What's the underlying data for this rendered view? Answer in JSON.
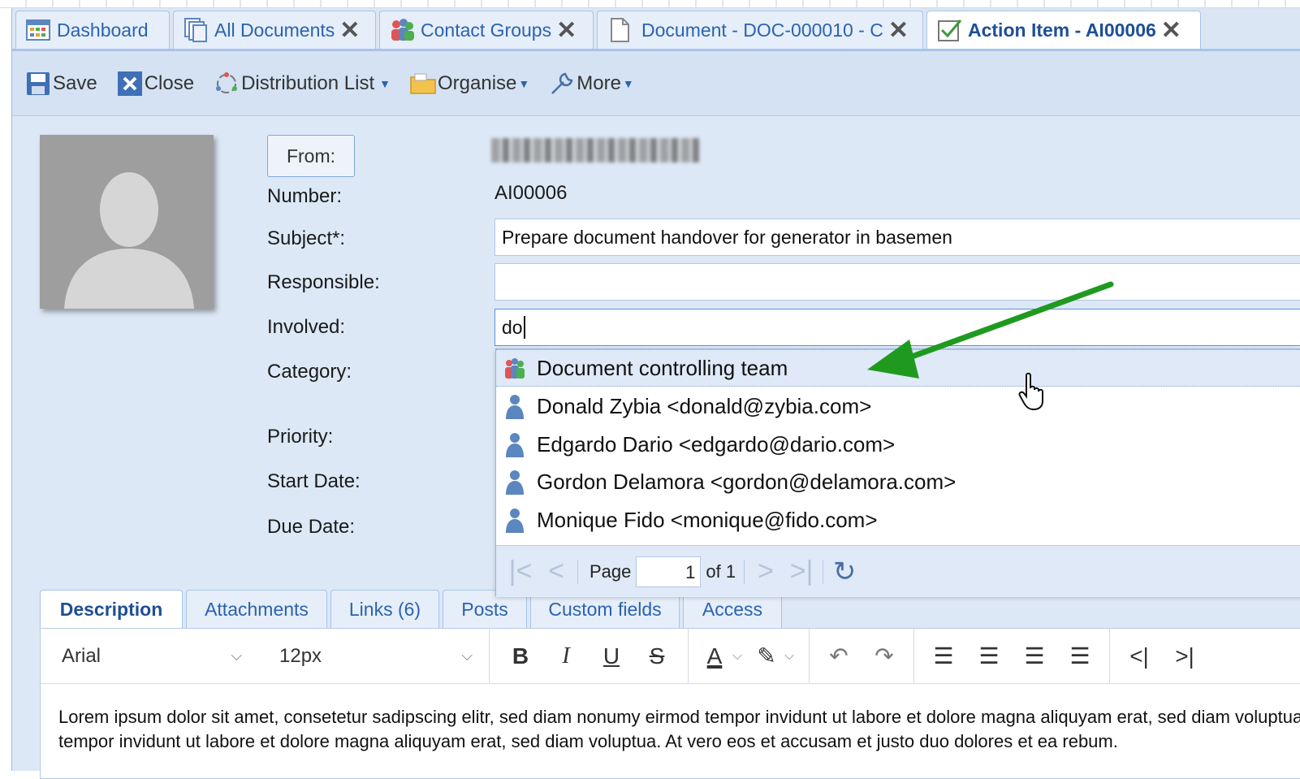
{
  "tabs": [
    {
      "label": "Dashboard",
      "icon": "dashboard-icon",
      "closable": false,
      "active": false
    },
    {
      "label": "All Documents",
      "icon": "documents-icon",
      "closable": true,
      "active": false
    },
    {
      "label": "Contact Groups",
      "icon": "contact-group-icon",
      "closable": true,
      "active": false
    },
    {
      "label": "Document - DOC-000010 - C",
      "icon": "document-icon",
      "closable": true,
      "active": false
    },
    {
      "label": "Action Item - AI00006",
      "icon": "checkbox-icon",
      "closable": true,
      "active": true
    }
  ],
  "toolbar": {
    "save": "Save",
    "close": "Close",
    "distribution_list": "Distribution List",
    "organise": "Organise",
    "more": "More"
  },
  "form": {
    "from_button": "From:",
    "number_label": "Number:",
    "number_value": "AI00006",
    "subject_label": "Subject*:",
    "subject_value": "Prepare document handover for generator in basemen",
    "responsible_label": "Responsible:",
    "responsible_value": "",
    "involved_label": "Involved:",
    "involved_value": "do",
    "category_label": "Category:",
    "priority_label": "Priority:",
    "start_date_label": "Start Date:",
    "due_date_label": "Due Date:"
  },
  "dropdown": {
    "items": [
      {
        "label": "Document controlling team",
        "icon": "contact-group-icon"
      },
      {
        "label": "Donald Zybia <donald@zybia.com>",
        "icon": "person-icon"
      },
      {
        "label": "Edgardo Dario <edgardo@dario.com>",
        "icon": "person-icon"
      },
      {
        "label": "Gordon Delamora <gordon@delamora.com>",
        "icon": "person-icon"
      },
      {
        "label": "Monique Fido <monique@fido.com>",
        "icon": "person-icon"
      }
    ],
    "pager": {
      "page_label": "Page",
      "page_value": "1",
      "of_label": "of 1"
    }
  },
  "bottom_tabs": [
    "Description",
    "Attachments",
    "Links (6)",
    "Posts",
    "Custom fields",
    "Access"
  ],
  "editor": {
    "font": "Arial",
    "size": "12px",
    "line1": "Lorem ipsum dolor sit amet, consetetur sadipscing elitr, sed diam nonumy eirmod tempor invidunt ut labore et dolore magna aliquyam erat, sed diam voluptua.",
    "line2": "tempor invidunt ut labore et dolore magna aliquyam erat, sed diam voluptua. At vero eos et accusam et justo duo dolores et ea rebum."
  },
  "colors": {
    "annotation_arrow": "#1f9a1f",
    "accent": "#2a63b0"
  }
}
